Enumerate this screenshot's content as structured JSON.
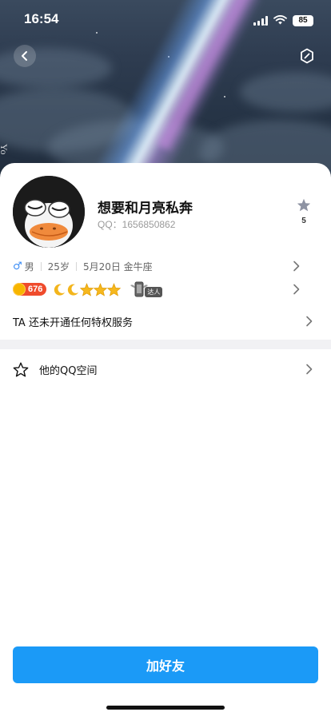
{
  "status_bar": {
    "time": "16:54",
    "battery": "85"
  },
  "cover": {
    "side_text": "Yo"
  },
  "profile": {
    "nickname": "想要和月亮私奔",
    "qq_label": "QQ：1656850862",
    "like_count": "5"
  },
  "info": {
    "gender": "男",
    "age": "25岁",
    "birthday_sign": "5月20日 金牛座"
  },
  "level": {
    "badge_value": "676",
    "icons": [
      "moon-icon",
      "moon-icon",
      "star-icon",
      "star-icon",
      "star-icon"
    ],
    "daren_label": "达人"
  },
  "privilege": {
    "text": "TA 还未开通任何特权服务"
  },
  "space": {
    "label": "他的QQ空间"
  },
  "actions": {
    "add_friend": "加好友"
  },
  "colors": {
    "accent": "#1b9af7",
    "level_badge": "#ef4b2c",
    "male": "#3b8cf5"
  }
}
